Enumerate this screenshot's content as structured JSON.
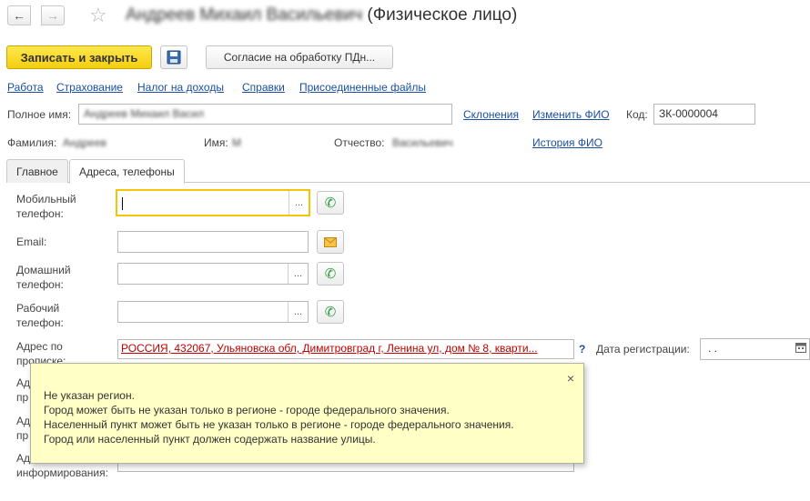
{
  "header": {
    "back_icon": "←",
    "forward_icon": "→",
    "star_icon": "☆",
    "title_blurred": "Андреев Михаил Васильевич",
    "title_suffix": " (Физическое лицо)"
  },
  "toolbar": {
    "save_close_label": "Записать и закрыть",
    "consent_label": "Согласие на обработку ПДн..."
  },
  "links": [
    "Работа",
    "Страхование",
    "Налог на доходы",
    "Справки",
    "Присоединенные файлы"
  ],
  "fullname": {
    "label": "Полное имя:",
    "value_blurred": "Андреев Михаил Васил",
    "declensions_link": "Склонения",
    "change_fio_link": "Изменить ФИО",
    "code_label": "Код:",
    "code_value": "ЗК-0000004"
  },
  "name_parts": {
    "surname_label": "Фамилия:",
    "surname_value": "Андреев",
    "name_label": "Имя:",
    "name_value": "М",
    "patronymic_label": "Отчество:",
    "patronymic_value": "Васильевич",
    "history_link": "История ФИО"
  },
  "tabs": [
    {
      "label": "Главное",
      "active": false
    },
    {
      "label": "Адреса, телефоны",
      "active": true
    }
  ],
  "form": {
    "mobile_label_1": "Мобильный",
    "mobile_label_2": "телефон:",
    "email_label": "Email:",
    "home_label_1": "Домашний",
    "home_label_2": "телефон:",
    "work_label_1": "Рабочий",
    "work_label_2": "телефон:",
    "reg_address_label_1": "Адрес по",
    "reg_address_label_2": "прописке:",
    "reg_address_value": "РОССИЯ, 432067, Ульяновска обл, Димитровград г, Ленина ул, дом № 8, кварти...",
    "help_mark": "?",
    "reg_date_label": "Дата регистрации:",
    "reg_date_value": ".  .",
    "hidden_label_a": "Ад",
    "hidden_label_a2": "пр",
    "hidden_label_b": "Ад",
    "hidden_label_b2": "пр",
    "hidden_label_c": "Ад",
    "info_label": "информирования:",
    "dots": "..."
  },
  "tooltip": {
    "close_icon": "×",
    "messages": [
      "Не указан регион.",
      "Город может быть не указан только в регионе - городе федерального значения.",
      "Населенный пункт может быть не указан только в регионе - городе федерального значения.",
      "Город или населенный пункт должен содержать название улицы."
    ]
  },
  "colors": {
    "accent_yellow": "#f4ce10",
    "link_blue": "#1c4fa0",
    "error_red": "#c00000",
    "tooltip_bg": "#ffffc6"
  }
}
